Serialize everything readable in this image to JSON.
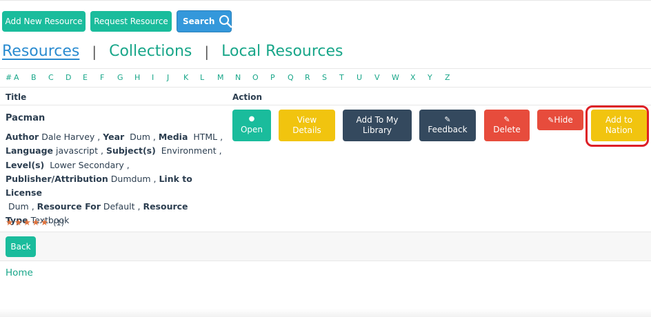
{
  "top_buttons": {
    "add_new": "Add New Resource",
    "request": "Request Resource",
    "search": "Search"
  },
  "tabs": [
    {
      "label": "Resources",
      "active": true
    },
    {
      "label": "Collections",
      "active": false
    },
    {
      "label": "Local Resources",
      "active": false
    }
  ],
  "alphabet": [
    "#",
    "A",
    "B",
    "C",
    "D",
    "E",
    "F",
    "G",
    "H",
    "I",
    "J",
    "K",
    "L",
    "M",
    "N",
    "O",
    "P",
    "Q",
    "R",
    "S",
    "T",
    "U",
    "V",
    "W",
    "X",
    "Y",
    "Z"
  ],
  "table": {
    "headers": {
      "title": "Title",
      "action": "Action"
    },
    "resource": {
      "title": "Pacman",
      "fields": {
        "author_label": "Author",
        "author": "Dale Harvey",
        "year_label": "Year",
        "year": "Dum",
        "media_label": "Media",
        "media": "HTML",
        "language_label": "Language",
        "language": "javascript",
        "subject_label": "Subject(s)",
        "subject": "Environment",
        "level_label": "Level(s)",
        "level": "Lower Secondary",
        "publisher_label": "Publisher/Attribution",
        "publisher": "Dumdum",
        "license_label": "Link to License",
        "license": "Dum",
        "resource_for_label": "Resource For",
        "resource_for": "Default",
        "resource_type_label_1": "Resource",
        "resource_type_label_2": "Type",
        "resource_type": "Textbook"
      },
      "rating": {
        "stars": 5,
        "count": "(1)"
      }
    },
    "actions": {
      "open": "Open",
      "view_line1": "View",
      "view_line2": "Details",
      "library_line1": "Add To My",
      "library_line2": "Library",
      "feedback": "Feedback",
      "delete": "Delete",
      "hide": "Hide",
      "nation_line1": "Add to",
      "nation_line2": "Nation"
    }
  },
  "back_button": "Back",
  "footer": {
    "home": "Home"
  },
  "colors": {
    "green": "#1abc9c",
    "blue": "#3498db",
    "yellow": "#f1c40f",
    "navy": "#34495e",
    "red": "#e74c3c",
    "highlight": "#dd1f26"
  }
}
